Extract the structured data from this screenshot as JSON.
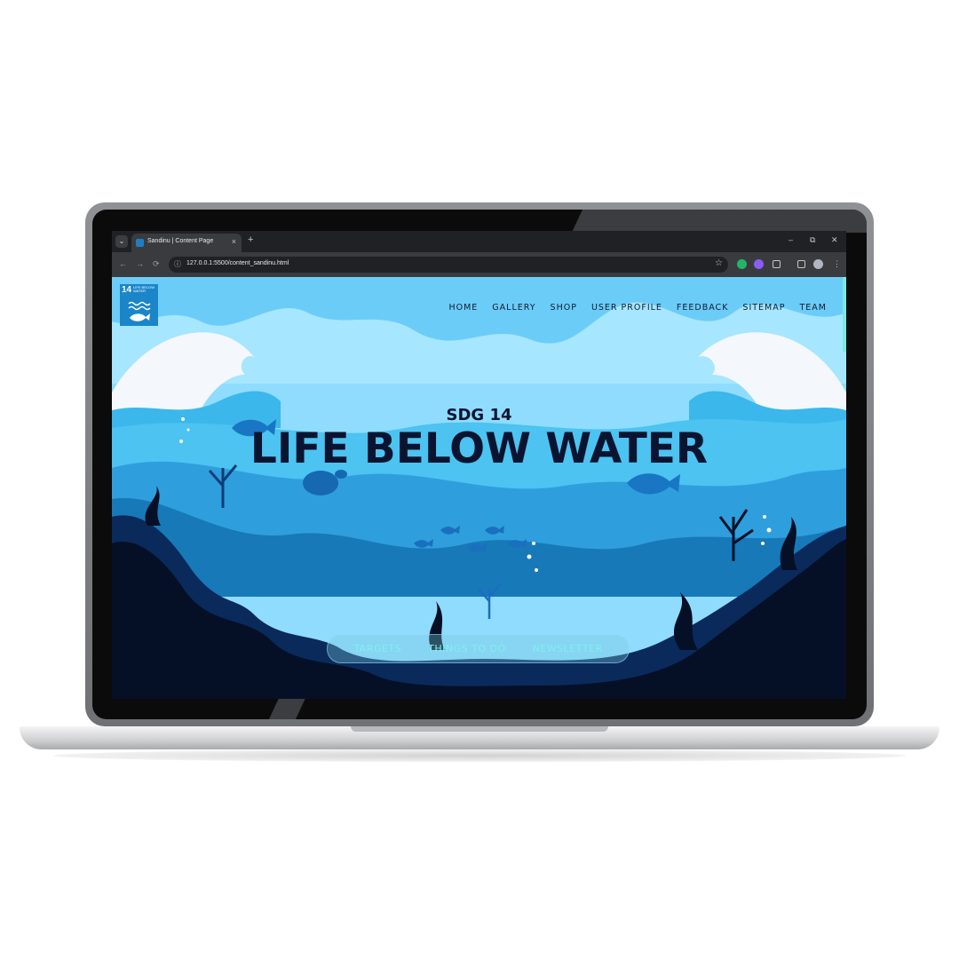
{
  "browser": {
    "tab_title": "Sandinu | Content Page",
    "tab_close": "×",
    "new_tab": "+",
    "url": "127.0.0.1:5500/content_sandinu.html",
    "window_controls": {
      "minimize": "–",
      "restore": "⧉",
      "close": "✕"
    }
  },
  "site": {
    "logo": {
      "number": "14",
      "text": "LIFE BELOW WATER"
    },
    "nav": [
      "HOME",
      "GALLERY",
      "SHOP",
      "USER PROFILE",
      "FEEDBACK",
      "SITEMAP",
      "TEAM"
    ],
    "hero": {
      "subtitle": "SDG 14",
      "title": "LIFE BELOW WATER"
    },
    "pill_nav": [
      "TARGETS",
      "THINGS TO DO",
      "NEWSLETTER"
    ]
  },
  "colors": {
    "sky": "#8fdcff",
    "deep_navy": "#051027",
    "mid_blue": "#1779b8",
    "light_blue": "#3bb7ec",
    "accent_cyan": "#7ff0ef",
    "logo_blue": "#1a86c9"
  }
}
